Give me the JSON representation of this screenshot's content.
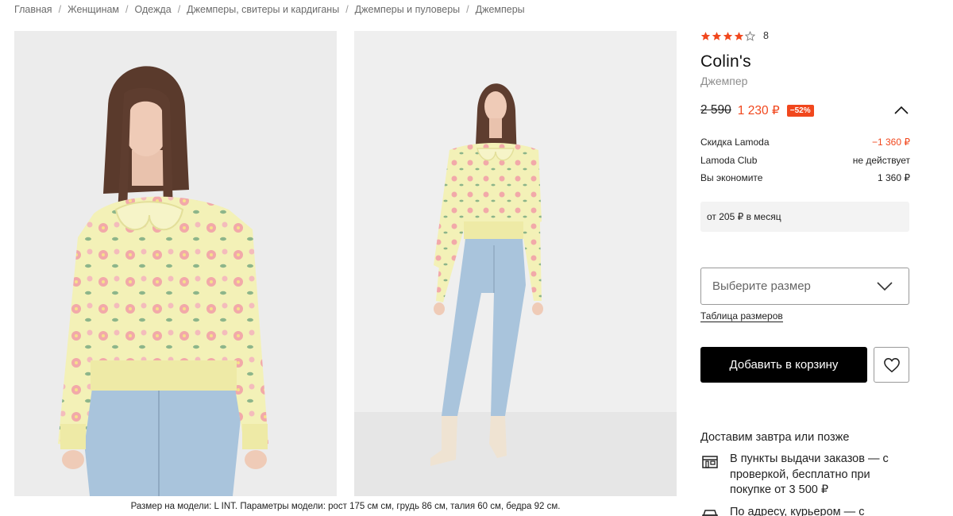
{
  "breadcrumbs": [
    "Главная",
    "Женщинам",
    "Одежда",
    "Джемперы, свитеры и кардиганы",
    "Джемперы и пуловеры",
    "Джемперы"
  ],
  "breadcrumb_separator": "/",
  "gallery": {
    "caption": "Размер на модели: L INT. Параметры модели: рост 175 см см, грудь 86 см, талия 60 см, бедра 92 см."
  },
  "product": {
    "rating": {
      "value": 4,
      "max": 5,
      "count": "8"
    },
    "brand": "Colin's",
    "type": "Джемпер",
    "price": {
      "old": "2 590",
      "new": "1 230 ₽",
      "discount": "−52%"
    },
    "details": [
      {
        "label": "Скидка Lamoda",
        "value": "−1 360 ₽",
        "highlight": true
      },
      {
        "label": "Lamoda Club",
        "value": "не действует",
        "highlight": false
      },
      {
        "label": "Вы экономите",
        "value": "1 360 ₽",
        "highlight": false
      }
    ],
    "installment": "от 205 ₽ в месяц",
    "size_select_placeholder": "Выберите размер",
    "size_table_link": "Таблица размеров",
    "add_to_cart": "Добавить в корзину"
  },
  "delivery": {
    "title": "Доставим завтра или позже",
    "options": [
      {
        "icon": "pickup-point-icon",
        "text": "В пункты выдачи заказов — с проверкой, бесплатно при покупке от 3 500 ₽"
      },
      {
        "icon": "courier-car-icon",
        "text": "По адресу, курьером — с"
      }
    ]
  },
  "colors": {
    "accent": "#f1471d",
    "button": "#000000",
    "sweater": "#f2f0b4",
    "flowers": "#f2a9a9",
    "jeans": "#a7c4de"
  }
}
